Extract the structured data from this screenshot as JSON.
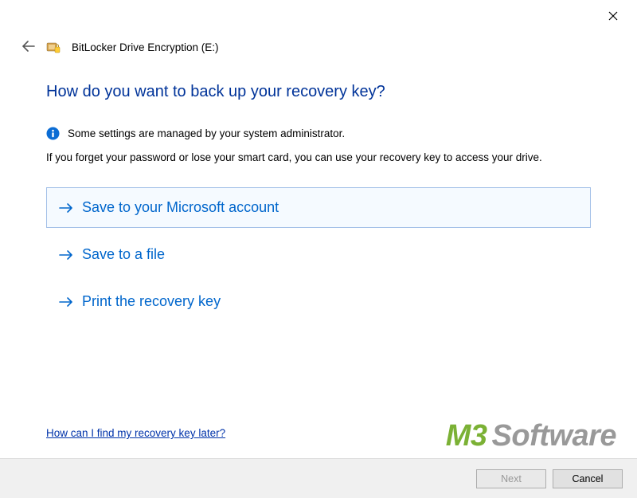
{
  "window": {
    "title": "BitLocker Drive Encryption (E:)"
  },
  "heading": "How do you want to back up your recovery key?",
  "info_text": "Some settings are managed by your system administrator.",
  "description": "If you forget your password or lose your smart card, you can use your recovery key to access your drive.",
  "options": {
    "ms_account": "Save to your Microsoft account",
    "save_file": "Save to a file",
    "print_key": "Print the recovery key"
  },
  "help_link": "How can I find my recovery key later?",
  "footer": {
    "next": "Next",
    "cancel": "Cancel"
  },
  "watermark": {
    "brand1": "M3",
    "brand2": "Software"
  }
}
